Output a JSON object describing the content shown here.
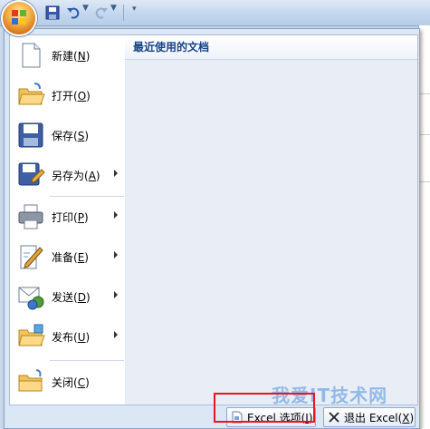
{
  "menu": {
    "items": [
      {
        "label": "新建",
        "mnemonic": "N",
        "icon": "new-document-icon",
        "submenu": false
      },
      {
        "label": "打开",
        "mnemonic": "O",
        "icon": "open-folder-icon",
        "submenu": false
      },
      {
        "label": "保存",
        "mnemonic": "S",
        "icon": "save-disk-icon",
        "submenu": false
      },
      {
        "label": "另存为",
        "mnemonic": "A",
        "icon": "save-as-icon",
        "submenu": true
      },
      {
        "label": "打印",
        "mnemonic": "P",
        "icon": "printer-icon",
        "submenu": true
      },
      {
        "label": "准备",
        "mnemonic": "E",
        "icon": "prepare-pen-icon",
        "submenu": true
      },
      {
        "label": "发送",
        "mnemonic": "D",
        "icon": "send-mail-icon",
        "submenu": true
      },
      {
        "label": "发布",
        "mnemonic": "U",
        "icon": "publish-folder-icon",
        "submenu": true
      },
      {
        "label": "关闭",
        "mnemonic": "C",
        "icon": "close-folder-icon",
        "submenu": false
      }
    ]
  },
  "recent": {
    "title": "最近使用的文档"
  },
  "footer": {
    "options_label": "Excel 选项",
    "options_mnemonic": "I",
    "exit_label": "退出 Excel",
    "exit_mnemonic": "X"
  },
  "watermark": "我爱IT技术网",
  "colors": {
    "highlight": "#e8141e",
    "office_orange": "#f6b448",
    "ribbon_blue": "#c3d6ee"
  }
}
